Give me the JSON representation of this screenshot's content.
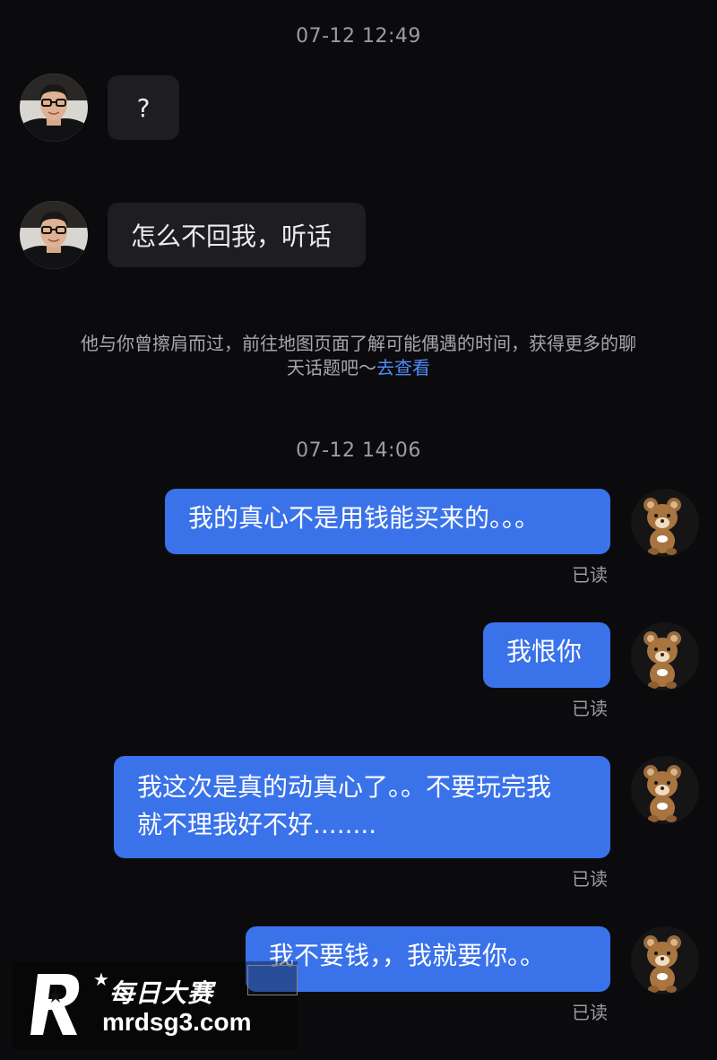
{
  "chat": {
    "timestamp_1": "07-12 12:49",
    "incoming_1": "?",
    "incoming_2": "怎么不回我，听话",
    "notice_text": "他与你曾擦肩而过，前往地图页面了解可能偶遇的时间，获得更多的聊天话题吧～",
    "notice_link": "去查看",
    "timestamp_2": "07-12 14:06",
    "outgoing_1": "我的真心不是用钱能买来的。。。",
    "outgoing_2": "我恨你",
    "outgoing_3_line1": "我这次是真的动真心了。。不要玩完我",
    "outgoing_3_line2": "就不理我好不好........",
    "outgoing_4": "我不要钱，，我就要你。。",
    "read_receipt": "已读"
  },
  "watermark": {
    "title": "每日大赛",
    "url": "mrdsg3.com"
  },
  "colors": {
    "background": "#0b0b0d",
    "incoming_bubble": "#1e1e21",
    "outgoing_bubble": "#3a72ea",
    "link": "#4f8bf6"
  },
  "icons": {
    "sender_avatar": "man-with-glasses-avatar",
    "self_avatar": "brown-bear-avatar",
    "watermark_logo": "r-star-logo"
  }
}
